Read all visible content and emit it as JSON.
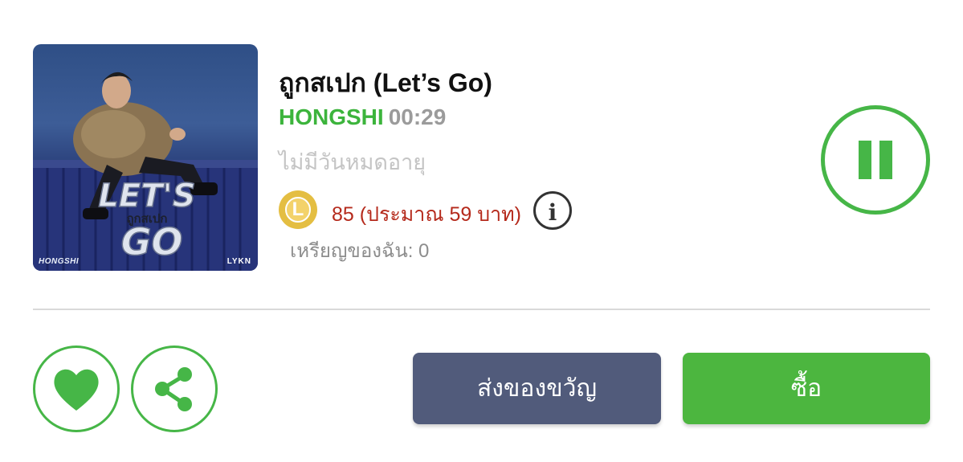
{
  "album": {
    "artist_tag": "HONGSHI",
    "label_tag": "LYKN",
    "cover_title_top": "LET'S",
    "cover_title_mid": "ถูกสเปก",
    "cover_title_bottom": "GO"
  },
  "track": {
    "title": "ถูกสเปก (Let’s Go)",
    "artist": "HONGSHI",
    "duration": "00:29",
    "validity": "ไม่มีวันหมดอายุ"
  },
  "price": {
    "coin_letter": "L",
    "text": "85 (ประมาณ 59 บาท)",
    "info_glyph": "i",
    "my_coins": "เหรียญของฉัน: 0"
  },
  "player": {
    "state": "playing"
  },
  "actions": {
    "gift_label": "ส่งของขวัญ",
    "buy_label": "ซื้อ"
  },
  "colors": {
    "accent_green": "#46b647",
    "price_red": "#b52a1c",
    "gift_button": "#515b7b",
    "buy_button": "#4cb63f",
    "coin_gold": "#e4be42"
  }
}
